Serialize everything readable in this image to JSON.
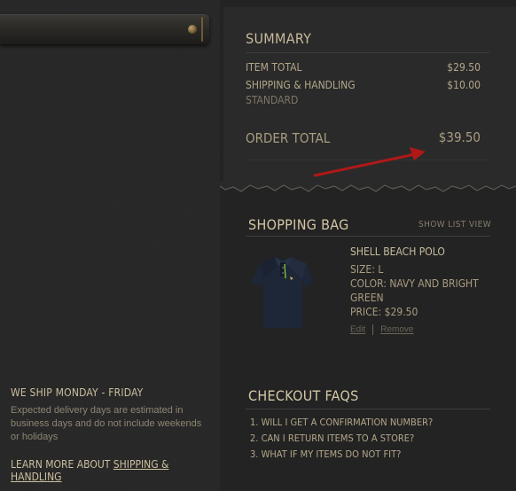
{
  "summary": {
    "title": "SUMMARY",
    "item_total_label": "ITEM TOTAL",
    "item_total_value": "$29.50",
    "shipping_label": "SHIPPING & HANDLING",
    "shipping_value": "$10.00",
    "shipping_method": "STANDARD",
    "order_total_label": "ORDER TOTAL",
    "order_total_value": "$39.50"
  },
  "shopping_bag": {
    "title": "SHOPPING BAG",
    "show_list_view": "SHOW LIST VIEW",
    "item": {
      "name": "SHELL BEACH POLO",
      "size": "SIZE: L",
      "color_line1": "COLOR: NAVY AND BRIGHT",
      "color_line2": "GREEN",
      "price": "PRICE: $29.50",
      "edit": "Edit",
      "remove": "Remove"
    }
  },
  "faqs": {
    "title": "CHECKOUT FAQS",
    "items": [
      "1. WILL I GET A CONFIRMATION NUMBER?",
      "2. CAN I RETURN ITEMS TO A STORE?",
      "3. WHAT IF MY ITEMS DO NOT FIT?"
    ]
  },
  "shipping_info": {
    "title": "WE SHIP MONDAY - FRIDAY",
    "text": "Expected delivery days are estimated in business days and do not include weekends or holidays",
    "learn_more_prefix": "LEARN MORE ABOUT ",
    "learn_more_link": "SHIPPING & HANDLING"
  },
  "icons": [
    "leather-strap-icon",
    "rivet-icon",
    "red-arrow-icon",
    "polo-shirt-image"
  ],
  "colors": {
    "arrow": "#b01818",
    "text": "#b9ac90",
    "background": "#232323"
  }
}
